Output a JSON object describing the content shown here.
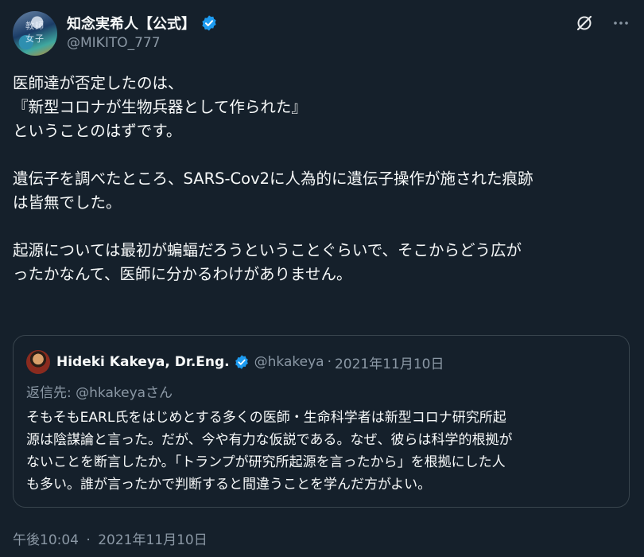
{
  "author": {
    "display_name": "知念実希人【公式】",
    "handle": "@MIKITO_777",
    "avatar_text": "教師 女子"
  },
  "header_icons": [
    "grok-slash-icon",
    "more-icon"
  ],
  "body": {
    "paragraphs": [
      [
        "医師達が否定したのは、",
        "『新型コロナが生物兵器として作られた』",
        "ということのはずです。"
      ],
      [
        "遺伝子を調べたところ、SARS-Cov2に人為的に遺伝子操作が施された痕跡",
        "は皆無でした。"
      ],
      [
        "起源については最初が蝙蝠だろうということぐらいで、そこからどう広が",
        "ったかなんて、医師に分かるわけがありません。"
      ]
    ]
  },
  "quoted_tweet": {
    "display_name": "Hideki Kakeya, Dr.Eng.",
    "handle": "@hkakeya",
    "separator": "·",
    "date": "2021年11月10日",
    "reply_to": "返信先: @hkakeyaさん",
    "text_lines": [
      "そもそもEARL氏をはじめとする多くの医師・生命科学者は新型コロナ研究所起",
      "源は陰謀論と言った。だが、今や有力な仮説である。なぜ、彼らは科学的根拠が",
      "ないことを断言したか。「トランプが研究所起源を言ったから」を根拠にした人",
      "も多い。誰が言ったかで判断すると間違うことを学んだ方がよい。"
    ]
  },
  "timestamp": {
    "time": "午後10:04",
    "separator": "·",
    "date": "2021年11月10日"
  },
  "colors": {
    "background": "#15202b",
    "text": "#f7f9f9",
    "muted": "#8b98a5",
    "border": "#38444d",
    "verified": "#1d9bf0"
  }
}
